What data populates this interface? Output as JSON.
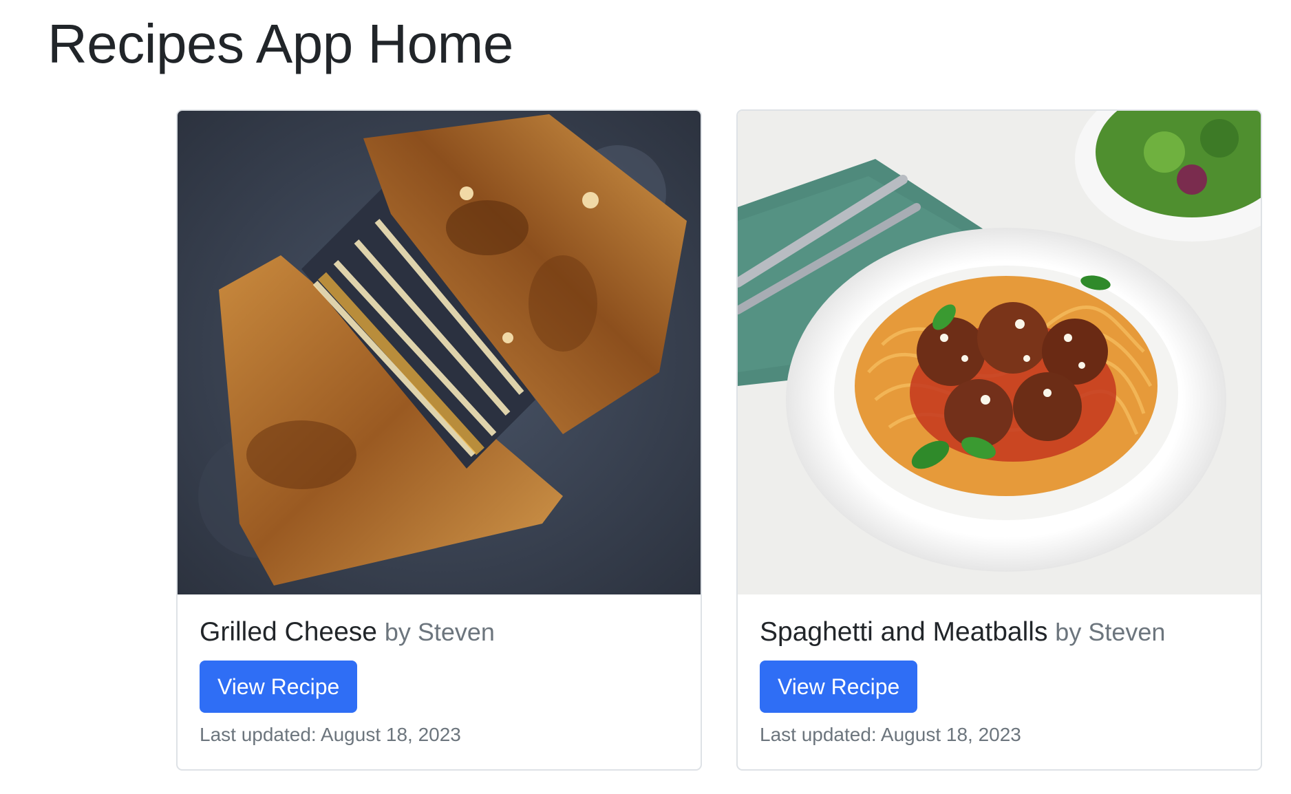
{
  "page": {
    "title": "Recipes App Home"
  },
  "recipes": [
    {
      "title": "Grilled Cheese",
      "author": "by Steven",
      "button_label": "View Recipe",
      "updated": "Last updated: August 18, 2023",
      "image_alt": "Grilled cheese sandwich"
    },
    {
      "title": "Spaghetti and Meatballs",
      "author": "by Steven",
      "button_label": "View Recipe",
      "updated": "Last updated: August 18, 2023",
      "image_alt": "Spaghetti and meatballs"
    }
  ],
  "colors": {
    "primary_button": "#2f6ef5",
    "text": "#212529",
    "muted_text": "#6c757d",
    "card_border": "#dee2e6"
  }
}
